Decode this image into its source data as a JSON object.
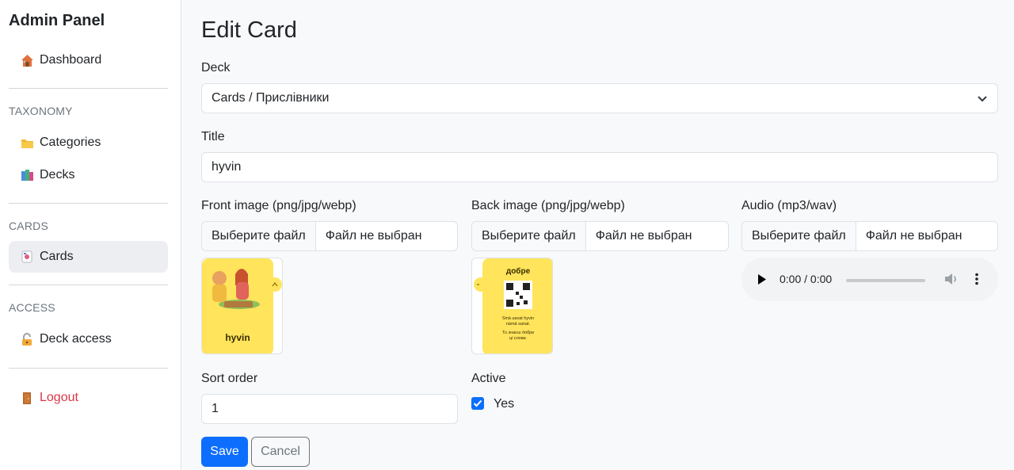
{
  "sidebar": {
    "brand": "Admin Panel",
    "dashboard": {
      "icon": "house-icon",
      "label": "Dashboard"
    },
    "taxonomy_label": "TAXONOMY",
    "categories": {
      "icon": "folder-icon",
      "label": "Categories"
    },
    "decks": {
      "icon": "books-icon",
      "label": "Decks"
    },
    "cards_label": "CARDS",
    "cards": {
      "icon": "card-icon",
      "label": "Cards"
    },
    "access_label": "ACCESS",
    "deck_access": {
      "icon": "lock-icon",
      "label": "Deck access"
    },
    "logout": {
      "icon": "door-icon",
      "label": "Logout"
    }
  },
  "form": {
    "title": "Edit Card",
    "deck_label": "Deck",
    "deck_value": "Cards / Прислівники",
    "title_label": "Title",
    "title_value": "hyvin",
    "front_label": "Front image (png/jpg/webp)",
    "back_label": "Back image (png/jpg/webp)",
    "audio_label": "Audio (mp3/wav)",
    "choose_file": "Выберите файл",
    "no_file": "Файл не выбран",
    "front_card_word": "hyvin",
    "back_card_word": "добре",
    "back_line1": "Sinä uaxat hyvin",
    "back_line2": "nämä sanat.",
    "back_line3": "Ти знаєш добре",
    "back_line4": "ці слова.",
    "audio_time": "0:00 / 0:00",
    "sort_label": "Sort order",
    "sort_value": "1",
    "active_label": "Active",
    "active_checked": true,
    "active_text": "Yes",
    "save": "Save",
    "cancel": "Cancel"
  },
  "colors": {
    "primary": "#0d6efd",
    "danger": "#dc3545",
    "card_yellow": "#ffe45c"
  }
}
